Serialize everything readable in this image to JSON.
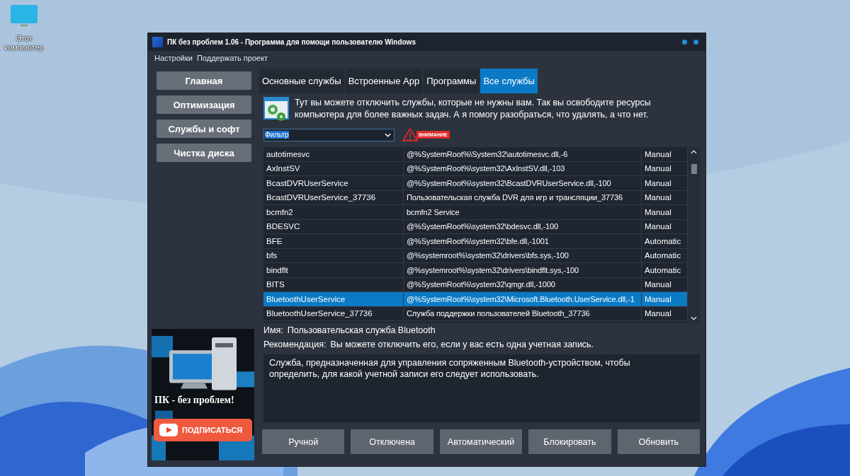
{
  "desktop": {
    "icons": [
      {
        "label": "Этот компьютер"
      }
    ]
  },
  "window": {
    "title": "ПК без проблем 1.06 - Программа для помощи пользователю Windows",
    "menu": [
      "Настройки",
      "Поддержать проект"
    ]
  },
  "sidebar": {
    "items": [
      {
        "label": "Главная"
      },
      {
        "label": "Оптимизация"
      },
      {
        "label": "Службы и софт"
      },
      {
        "label": "Чистка диска"
      }
    ],
    "banner": {
      "caption": "ПК - без проблем!",
      "subscribe": "ПОДПИСАТЬСЯ"
    }
  },
  "tabs": [
    {
      "label": "Основные службы",
      "selected": false
    },
    {
      "label": "Встроенные App",
      "selected": false
    },
    {
      "label": "Программы",
      "selected": false
    },
    {
      "label": "Все службы",
      "selected": true
    }
  ],
  "intro": "Тут вы можете отключить службы, которые не нужны вам. Так вы освободите ресурсы компьютера для более важных задач. А я помогу разобраться, что удалять, а что нет.",
  "filter": {
    "value": "Фильтр"
  },
  "warning": "ВНИМАНИЕ",
  "table": {
    "rows": [
      {
        "cells": [
          "autotimesvc",
          "@%SystemRoot%\\System32\\autotimesvc.dll,-6",
          "Manual"
        ],
        "selected": false
      },
      {
        "cells": [
          "AxInstSV",
          "@%SystemRoot%\\system32\\AxInstSV.dll,-103",
          "Manual"
        ],
        "selected": false
      },
      {
        "cells": [
          "BcastDVRUserService",
          "@%SystemRoot%\\system32\\BcastDVRUserService.dll,-100",
          "Manual"
        ],
        "selected": false
      },
      {
        "cells": [
          "BcastDVRUserService_37736",
          "Пользовательская служба DVR для игр и трансляции_37736",
          "Manual"
        ],
        "selected": false
      },
      {
        "cells": [
          "bcmfn2",
          "bcmfn2 Service",
          "Manual"
        ],
        "selected": false
      },
      {
        "cells": [
          "BDESVC",
          "@%SystemRoot%\\system32\\bdesvc.dll,-100",
          "Manual"
        ],
        "selected": false
      },
      {
        "cells": [
          "BFE",
          "@%SystemRoot%\\system32\\bfe.dll,-1001",
          "Automatic"
        ],
        "selected": false
      },
      {
        "cells": [
          "bfs",
          "@%systemroot%\\system32\\drivers\\bfs.sys,-100",
          "Automatic"
        ],
        "selected": false
      },
      {
        "cells": [
          "bindflt",
          "@%systemroot%\\system32\\drivers\\bindflt.sys,-100",
          "Automatic"
        ],
        "selected": false
      },
      {
        "cells": [
          "BITS",
          "@%SystemRoot%\\system32\\qmgr.dll,-1000",
          "Manual"
        ],
        "selected": false
      },
      {
        "cells": [
          "BluetoothUserService",
          "@%SystemRoot%\\system32\\Microsoft.Bluetooth.UserService.dll,-1",
          "Manual"
        ],
        "selected": true
      },
      {
        "cells": [
          "BluetoothUserService_37736",
          "Служба поддержки пользователей Bluetooth_37736",
          "Manual"
        ],
        "selected": false
      }
    ]
  },
  "details": {
    "name_label": "Имя:",
    "name": "Пользовательская служба Bluetooth",
    "recommendation_label": "Рекомендация:",
    "recommendation": "Вы можете отключить его, если у вас есть одна учетная запись.",
    "description": "Служба, предназначенная для управления сопряженным Bluetooth-устройством, чтобы определить, для какой учетной записи его следует использовать."
  },
  "buttons": [
    "Ручной",
    "Отключена",
    "Автоматический",
    "Блокировать",
    "Обновить"
  ]
}
